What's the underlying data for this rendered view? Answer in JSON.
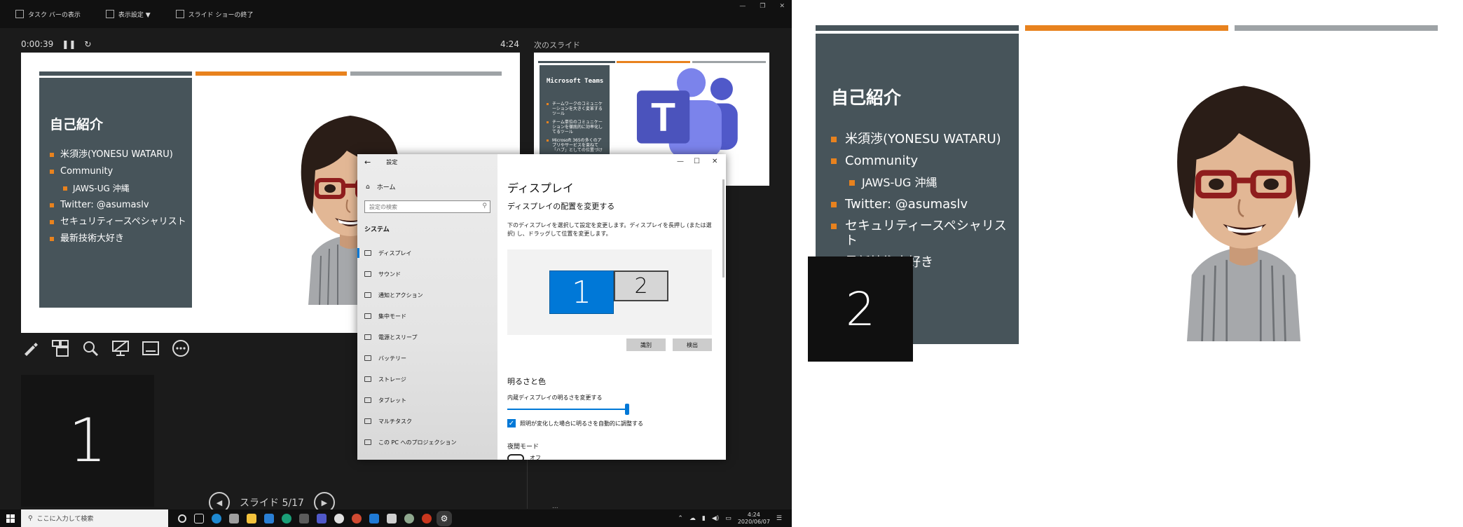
{
  "presenter": {
    "toolbar": {
      "taskbar_toggle": "タスク バーの表示",
      "display_settings": "表示設定 ▼",
      "end_show": "スライド ショーの終了"
    },
    "elapsed": "0:00:39",
    "clock": "4:24",
    "next_label": "次のスライド",
    "current_slide": {
      "title": "自己紹介",
      "bullets": [
        {
          "text": "米須渉(YONESU WATARU)",
          "level": 1
        },
        {
          "text": "Community",
          "level": 1
        },
        {
          "text": "JAWS-UG 沖縄",
          "level": 2
        },
        {
          "text": "Twitter: @asumaslv",
          "level": 1
        },
        {
          "text": "セキュリティースペシャリスト",
          "level": 1
        },
        {
          "text": "最新技術大好き",
          "level": 1
        }
      ]
    },
    "next_slide": {
      "title": "Microsoft Teams",
      "bullets": [
        "チームワークのコミュニケーションを大きく変革するツール",
        "チーム単位のコミュニケーションを徹底的に効率化してるツール",
        "Microsoft 365の多くのアプリやサービスを束ねて「ハブ」としての位置づけ"
      ]
    },
    "monitor_identify": "1",
    "slide_counter": "スライド 5/17",
    "notes_peek": "..."
  },
  "settings": {
    "app_title": "設定",
    "home": "ホーム",
    "search_placeholder": "設定の検索",
    "section": "システム",
    "nav": [
      "ディスプレイ",
      "サウンド",
      "通知とアクション",
      "集中モード",
      "電源とスリープ",
      "バッテリー",
      "ストレージ",
      "タブレット",
      "マルチタスク",
      "この PC へのプロジェクション"
    ],
    "heading": "ディスプレイ",
    "subheading": "ディスプレイの配置を変更する",
    "description": "下のディスプレイを選択して設定を変更します。ディスプレイを長押し (または選択) し、ドラッグして位置を変更します。",
    "monitor1": "1",
    "monitor2": "2",
    "identify_btn": "識別",
    "detect_btn": "検出",
    "brightness_heading": "明るさと色",
    "brightness_label": "内蔵ディスプレイの明るさを変更する",
    "brightness_value": 0.83,
    "auto_brightness": "照明が変化した場合に明るさを自動的に調整する",
    "night_mode": "夜間モード",
    "night_state": "オフ",
    "accent": "#0078d7"
  },
  "taskbar": {
    "search_placeholder": "ここに入力して検索",
    "time": "4:24",
    "date": "2020/06/07"
  },
  "projected": {
    "title": "自己紹介",
    "bullets": [
      {
        "text": "米須渉(YONESU WATARU)",
        "level": 1
      },
      {
        "text": "Community",
        "level": 1
      },
      {
        "text": "JAWS-UG 沖縄",
        "level": 2
      },
      {
        "text": "Twitter: @asumaslv",
        "level": 1
      },
      {
        "text": "セキュリティースペシャリスト",
        "level": 1
      },
      {
        "text": "最新技術大好き",
        "level": 1
      }
    ],
    "monitor_identify": "2"
  },
  "colors": {
    "panel": "#47545a",
    "accent_orange": "#e8821e",
    "bar_gray": "#9ea3a6"
  }
}
